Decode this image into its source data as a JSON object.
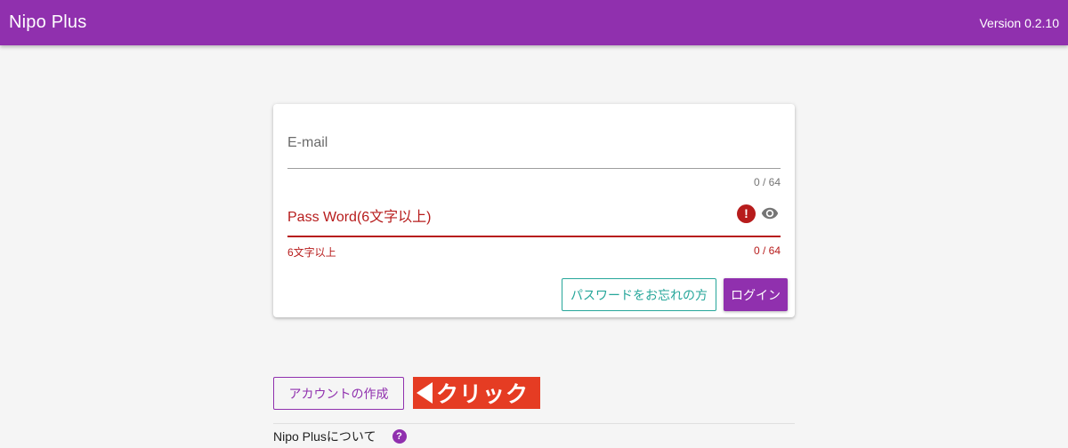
{
  "app_bar": {
    "title": "Nipo Plus",
    "version": "Version 0.2.10"
  },
  "login_form": {
    "email": {
      "label": "E-mail",
      "value": "",
      "counter": "0 / 64"
    },
    "password": {
      "label": "Pass Word(6文字以上)",
      "value": "",
      "error_hint": "6文字以上",
      "counter": "0 / 64",
      "error_icon": "exclamation-circle-icon",
      "toggle_icon": "eye-icon"
    },
    "forgot_button": "パスワードをお忘れの方",
    "login_button": "ログイン"
  },
  "create_account_button": "アカウントの作成",
  "annotation_callout": "クリック",
  "about": {
    "label": "Nipo Plusについて",
    "icon": "help-circle-icon"
  },
  "colors": {
    "primary": "#9030ae",
    "error": "#b71c1c",
    "teal": "#26a69a",
    "callout": "#e53c23"
  }
}
